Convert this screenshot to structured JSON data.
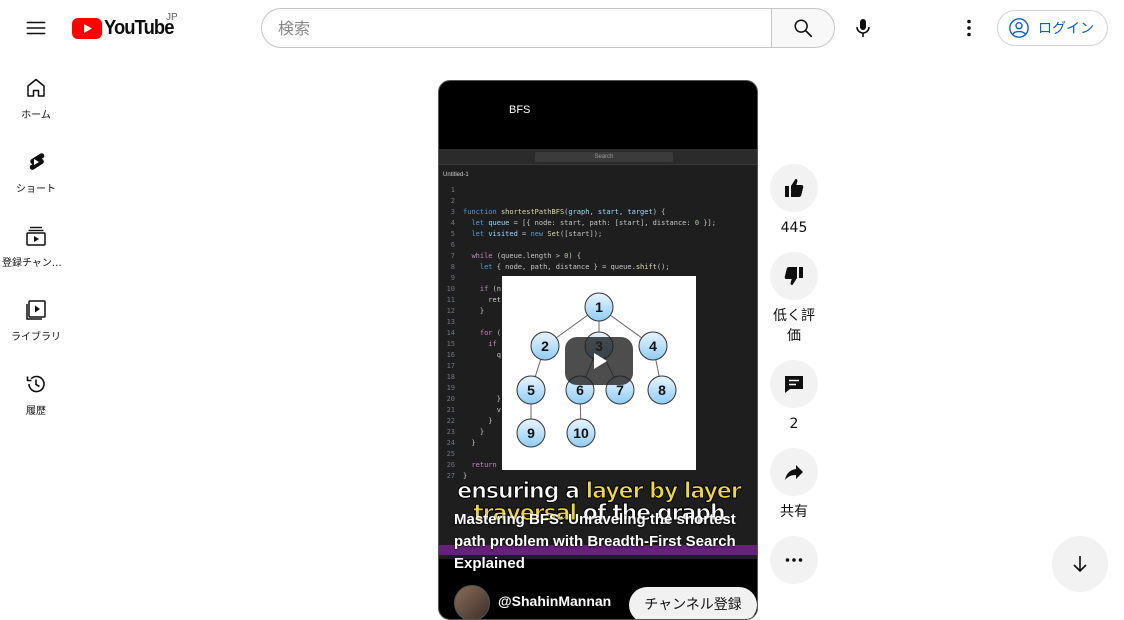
{
  "masthead": {
    "logo_text": "YouTube",
    "region": "JP",
    "search_placeholder": "検索",
    "login_label": "ログイン"
  },
  "guide": {
    "items": [
      {
        "label": "ホーム",
        "icon": "home-icon"
      },
      {
        "label": "ショート",
        "icon": "shorts-icon"
      },
      {
        "label": "登録チャンネル",
        "icon": "subscriptions-icon"
      },
      {
        "label": "ライブラリ",
        "icon": "library-icon"
      },
      {
        "label": "履歴",
        "icon": "history-icon"
      }
    ]
  },
  "short": {
    "overlay_label": "BFS",
    "editor_tab": "Untitled-1",
    "editor_search": "Search",
    "graph_nodes": [
      "1",
      "2",
      "3",
      "4",
      "5",
      "6",
      "7",
      "8",
      "9",
      "10"
    ],
    "caption_white": "ensuring a",
    "caption_yellow": "layer by layer traversal",
    "caption_white2": "of the graph",
    "title": "Mastering BFS: Unraveling the shortest path problem with Breadth-First Search Explained",
    "channel_name": "@ShahinMannan",
    "subscribe_label": "チャンネル登録"
  },
  "actions": {
    "like_count": "445",
    "dislike_label": "低く評価",
    "comment_count": "2",
    "share_label": "共有"
  },
  "colors": {
    "brand_red": "#ff0000",
    "link_blue": "#065fd4",
    "caption_yellow": "#f2d92e"
  }
}
